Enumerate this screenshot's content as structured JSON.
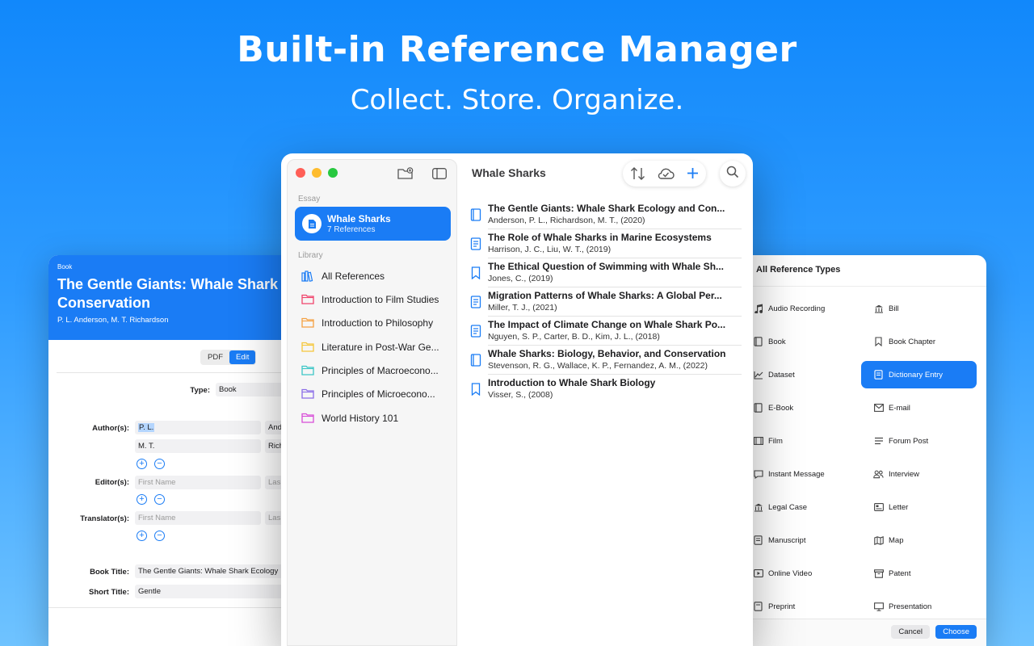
{
  "hero": {
    "title": "Built-in Reference Manager",
    "subtitle": "Collect. Store. Organize."
  },
  "edit_panel": {
    "kind": "Book",
    "title_line1": "The Gentle Giants: Whale Shark",
    "title_line2": "Conservation",
    "authors": "P. L. Anderson, M. T. Richardson",
    "segment": [
      "PDF",
      "Edit"
    ],
    "active_segment": "Edit",
    "type_label": "Type:",
    "type_value": "Book",
    "authors_label": "Author(s):",
    "author1_first": "P. L.",
    "author1_last": "And",
    "author2_first": "M. T.",
    "author2_last": "Rich",
    "editors_label": "Editor(s):",
    "translators_label": "Translator(s):",
    "first_name_placeholder": "First Name",
    "last_name_placeholder": "Las",
    "book_title_label": "Book Title:",
    "book_title_value": "The Gentle Giants: Whale Shark Ecology",
    "short_title_label": "Short Title:",
    "short_title_value": "Gentle"
  },
  "main": {
    "sidebar": {
      "essay_section": "Essay",
      "essay_item": {
        "name": "Whale Sharks",
        "count": "7 References"
      },
      "library_section": "Library",
      "library_items": [
        {
          "label": "All References",
          "icon": "books-icon",
          "color": "#1a7cf5"
        },
        {
          "label": "Introduction to Film Studies",
          "icon": "folder-icon",
          "color": "#f0436b"
        },
        {
          "label": "Introduction to Philosophy",
          "icon": "folder-icon",
          "color": "#f5a142"
        },
        {
          "label": "Literature in Post-War Ge...",
          "icon": "folder-icon",
          "color": "#f5c73b"
        },
        {
          "label": "Principles of Macroecono...",
          "icon": "folder-icon",
          "color": "#3cc6c6"
        },
        {
          "label": "Principles of Microecono...",
          "icon": "folder-icon",
          "color": "#8b6de8"
        },
        {
          "label": "World History 101",
          "icon": "folder-icon",
          "color": "#d84cd8"
        }
      ]
    },
    "content_title": "Whale Sharks",
    "references": [
      {
        "title": "The Gentle Giants: Whale Shark Ecology and Con...",
        "authors": "Anderson, P. L., Richardson, M. T., (2020)",
        "icon": "book-icon"
      },
      {
        "title": "The Role of Whale Sharks in Marine Ecosystems",
        "authors": "Harrison, J. C., Liu, W. T., (2019)",
        "icon": "document-icon"
      },
      {
        "title": "The Ethical Question of Swimming with Whale Sh...",
        "authors": "Jones, C., (2019)",
        "icon": "bookmark-icon"
      },
      {
        "title": "Migration Patterns of Whale Sharks: A Global Per...",
        "authors": "Miller, T. J., (2021)",
        "icon": "document-icon"
      },
      {
        "title": "The Impact of Climate Change on Whale Shark Po...",
        "authors": "Nguyen, S. P., Carter, B. D., Kim, J. L., (2018)",
        "icon": "document-icon"
      },
      {
        "title": "Whale Sharks: Biology, Behavior, and Conservation",
        "authors": "Stevenson, R. G., Wallace, K. P., Fernandez, A. M., (2022)",
        "icon": "book-icon"
      },
      {
        "title": "Introduction to Whale Shark Biology",
        "authors": "Visser, S., (2008)",
        "icon": "bookmark-icon"
      }
    ]
  },
  "types_panel": {
    "title": "All Reference Types",
    "left_column": [
      {
        "label": "Audio Recording",
        "icon": "music-note-icon"
      },
      {
        "label": "Book",
        "icon": "book-icon"
      },
      {
        "label": "Dataset",
        "icon": "chart-icon"
      },
      {
        "label": "E-Book",
        "icon": "ebook-icon"
      },
      {
        "label": "Film",
        "icon": "film-icon"
      },
      {
        "label": "Instant Message",
        "icon": "chat-bubble-icon"
      },
      {
        "label": "Legal Case",
        "icon": "courthouse-icon"
      },
      {
        "label": "Manuscript",
        "icon": "manuscript-icon"
      },
      {
        "label": "Online Video",
        "icon": "play-icon"
      },
      {
        "label": "Preprint",
        "icon": "preprint-icon"
      }
    ],
    "right_column": [
      {
        "label": "Bill",
        "icon": "building-columns-icon"
      },
      {
        "label": "Book Chapter",
        "icon": "bookmark-icon"
      },
      {
        "label": "Dictionary Entry",
        "icon": "dictionary-icon",
        "selected": true
      },
      {
        "label": "E-mail",
        "icon": "envelope-icon"
      },
      {
        "label": "Forum Post",
        "icon": "lines-icon"
      },
      {
        "label": "Interview",
        "icon": "people-icon"
      },
      {
        "label": "Letter",
        "icon": "letter-icon"
      },
      {
        "label": "Map",
        "icon": "map-icon"
      },
      {
        "label": "Patent",
        "icon": "archive-box-icon"
      },
      {
        "label": "Presentation",
        "icon": "presentation-icon"
      }
    ],
    "cancel_label": "Cancel",
    "choose_label": "Choose"
  },
  "colors": {
    "accent": "#1a7cf5",
    "close": "#ff5f57",
    "minimize": "#febc2e",
    "zoom": "#28c840"
  }
}
